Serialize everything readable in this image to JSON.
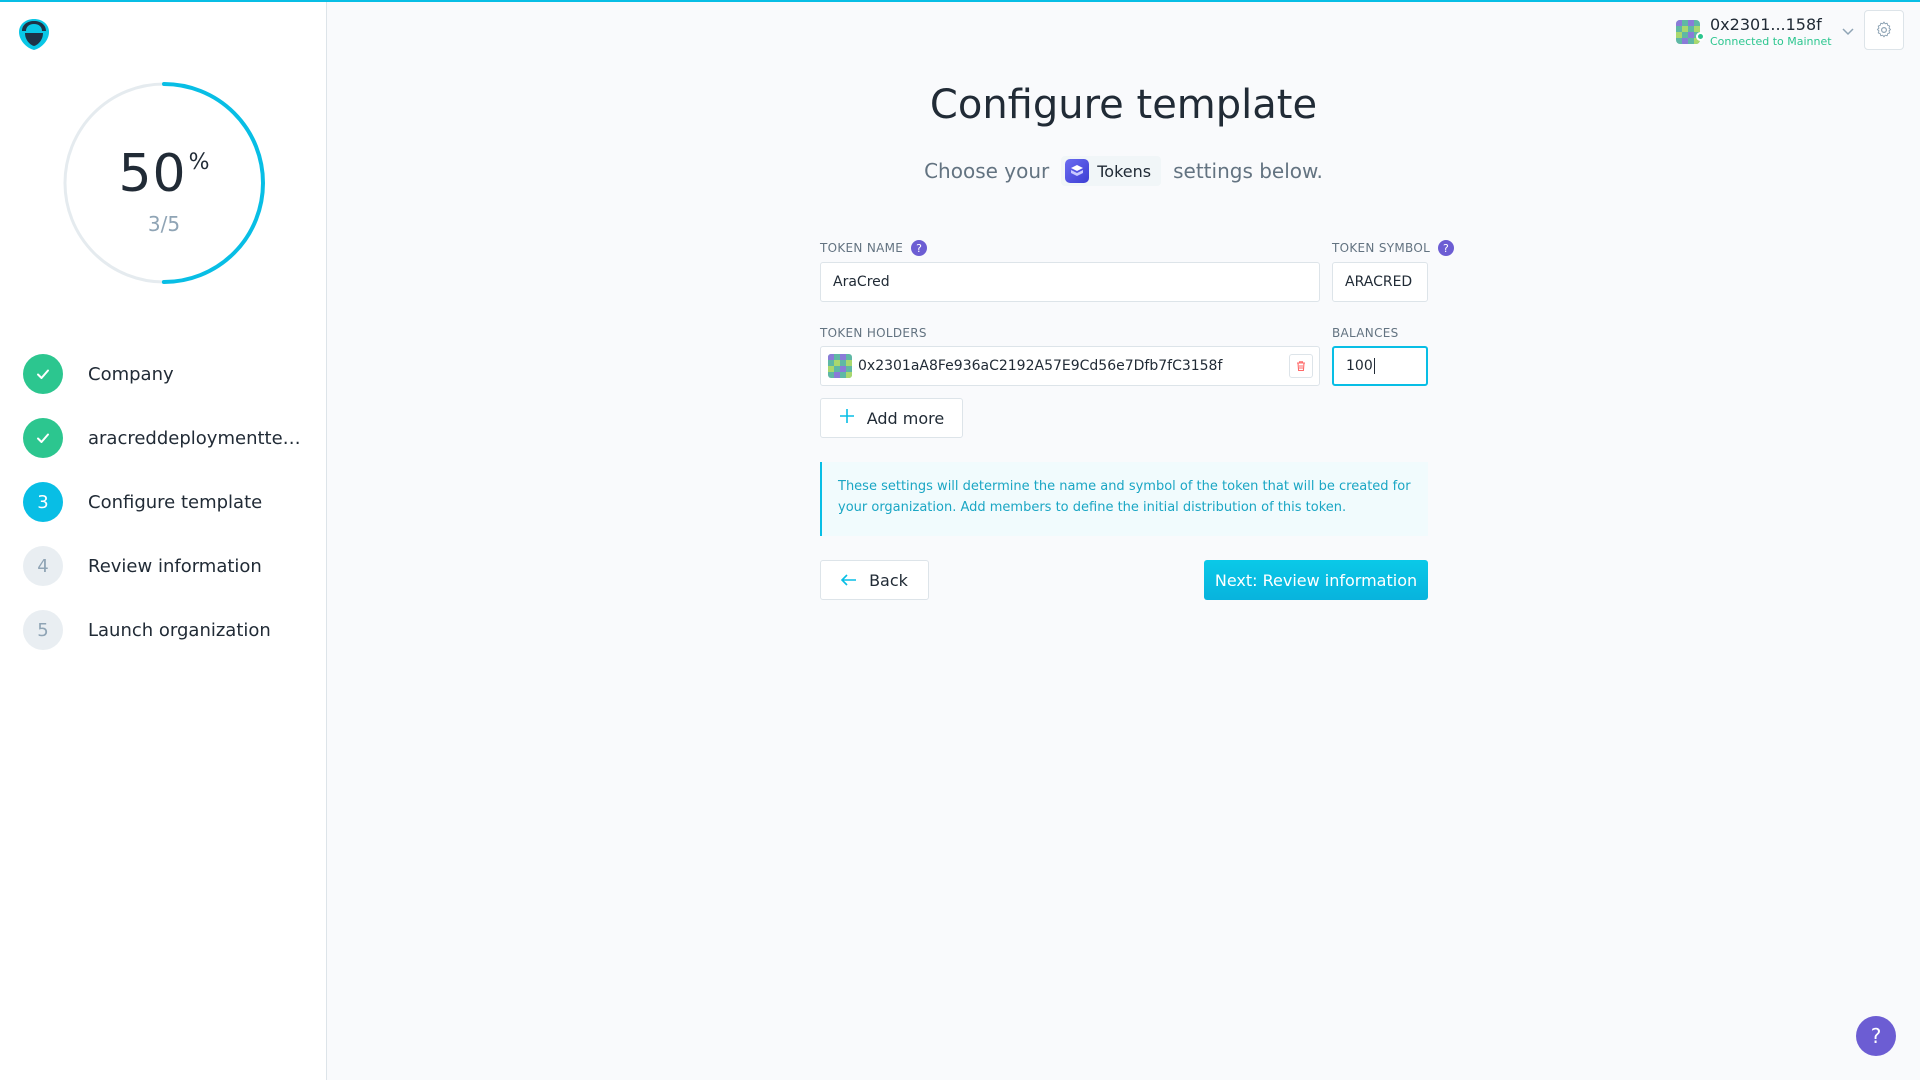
{
  "progress": {
    "percent_value": 50,
    "percent_number": "50",
    "percent_sign": "%",
    "fraction": "3/5",
    "fill": 0.5
  },
  "steps": [
    {
      "label": "Company",
      "badge": "",
      "status": "done"
    },
    {
      "label": "aracreddeploymenttesti...",
      "badge": "",
      "status": "done"
    },
    {
      "label": "Configure template",
      "badge": "3",
      "status": "active"
    },
    {
      "label": "Review information",
      "badge": "4",
      "status": "pending"
    },
    {
      "label": "Launch organization",
      "badge": "5",
      "status": "pending"
    }
  ],
  "account": {
    "address": "0x2301...158f",
    "network": "Connected to Mainnet"
  },
  "main": {
    "title": "Configure template",
    "subtitle_before": "Choose your",
    "template_name": "Tokens",
    "subtitle_after": "settings below."
  },
  "form": {
    "token_name_label": "TOKEN NAME",
    "token_name_value": "AraCred",
    "token_symbol_label": "TOKEN SYMBOL",
    "token_symbol_value": "ARACRED",
    "token_holders_label": "TOKEN HOLDERS",
    "holder_address": "0x2301aA8Fe936aC2192A57E9Cd56e7Dfb7fC3158f",
    "balances_label": "BALANCES",
    "balance_value": "100",
    "add_more_label": "Add more",
    "info_text": "These settings will determine the name and symbol of the token that will be created for your organization. Add members to define the initial distribution of this token.",
    "back_label": "Back",
    "next_label": "Next: Review information"
  },
  "help": {
    "fab_label": "?",
    "field_help": "?"
  },
  "colors": {
    "accent": "#08bee5",
    "success": "#2cc68f",
    "help": "#6c5dd3"
  },
  "icons": {
    "logo": "aragon-logo-icon",
    "check": "check-icon",
    "settings": "gear-icon",
    "chevron": "chevron-down-icon",
    "remove": "trash-icon",
    "add": "plus-icon",
    "back": "arrow-left-icon"
  }
}
